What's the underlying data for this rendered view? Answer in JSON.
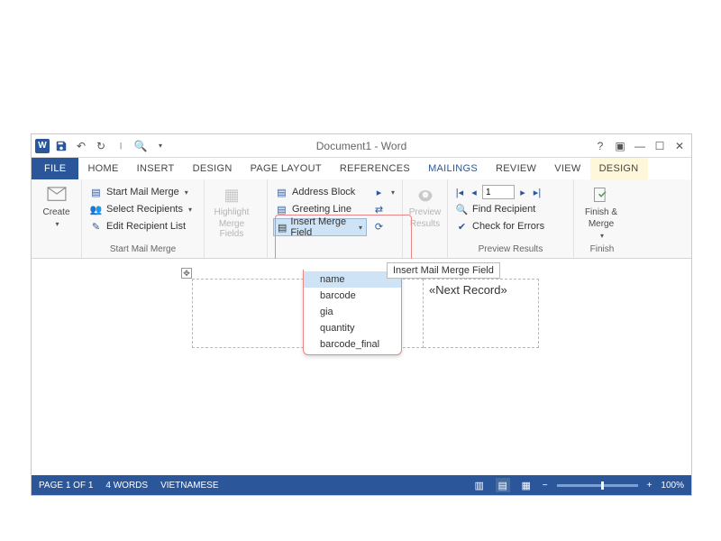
{
  "title": "Document1 - Word",
  "tabs": {
    "file": "FILE",
    "home": "HOME",
    "insert": "INSERT",
    "design": "DESIGN",
    "page_layout": "PAGE LAYOUT",
    "references": "REFERENCES",
    "mailings": "MAILINGS",
    "review": "REVIEW",
    "view": "VIEW",
    "design2": "DESIGN"
  },
  "ribbon": {
    "create_group": {
      "create": "Create"
    },
    "start_group": {
      "start_mail_merge": "Start Mail Merge",
      "select_recipients": "Select Recipients",
      "edit_recipient_list": "Edit Recipient List",
      "label": "Start Mail Merge"
    },
    "highlight": {
      "line1": "Highlight",
      "line2": "Merge Fields"
    },
    "write_group": {
      "address_block": "Address Block",
      "greeting_line": "Greeting Line",
      "insert_merge_field": "Insert Merge Field"
    },
    "preview": {
      "line1": "Preview",
      "line2": "Results"
    },
    "preview_group": {
      "record_value": "1",
      "find_recipient": "Find Recipient",
      "check_errors": "Check for Errors",
      "label": "Preview Results"
    },
    "finish": {
      "line1": "Finish &",
      "line2": "Merge",
      "label": "Finish"
    }
  },
  "dropdown": {
    "items": [
      "name",
      "barcode",
      "gia",
      "quantity",
      "barcode_final"
    ]
  },
  "tooltip": "Insert Mail Merge Field",
  "document": {
    "cell_text": "«Next Record»"
  },
  "statusbar": {
    "page": "PAGE 1 OF 1",
    "words": "4 WORDS",
    "language": "VIETNAMESE",
    "zoom": "100%"
  }
}
